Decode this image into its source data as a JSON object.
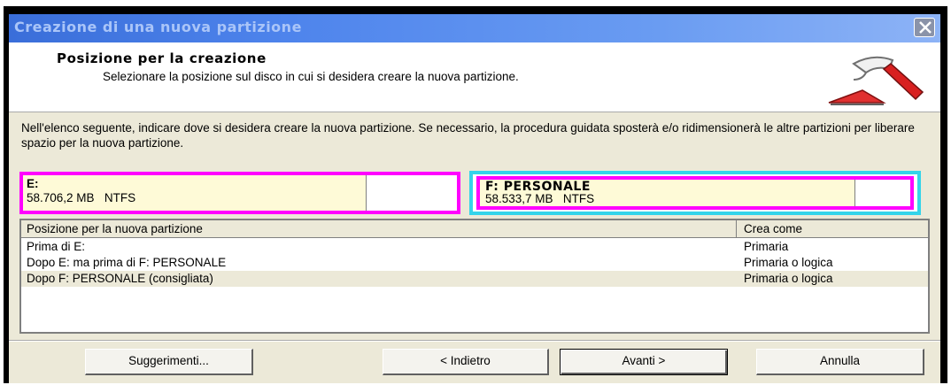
{
  "window": {
    "title": "Creazione di una nuova partizione"
  },
  "header": {
    "title": "Posizione per la creazione",
    "subtitle": "Selezionare la posizione sul disco in cui si desidera creare la nuova partizione."
  },
  "intro": "Nell'elenco seguente, indicare dove si desidera creare la nuova partizione. Se necessario, la procedura guidata sposterà e/o ridimensionerà le altre partizioni per liberare spazio per la nuova partizione.",
  "partitions": [
    {
      "name": "E:",
      "size": "58.706,2 MB",
      "fs": "NTFS",
      "used_fraction": 0.79
    },
    {
      "name": "F:  PERSONALE",
      "size": "58.533,7 MB",
      "fs": "NTFS",
      "used_fraction": 0.87
    }
  ],
  "list": {
    "columns": [
      "Posizione per la nuova partizione",
      "Crea come"
    ],
    "rows": [
      {
        "position": "Prima di E:",
        "type": "Primaria"
      },
      {
        "position": "Dopo E:  ma prima di F: PERSONALE",
        "type": "Primaria o logica"
      },
      {
        "position": "Dopo F: PERSONALE  (consigliata)",
        "type": "Primaria o logica"
      }
    ]
  },
  "buttons": {
    "hints": "Suggerimenti...",
    "back": "< Indietro",
    "next": "Avanti >",
    "cancel": "Annulla"
  },
  "colors": {
    "selection_outline": "#ff00ff",
    "focus_outline": "#34d4ea",
    "used_space": "#fefad7"
  }
}
